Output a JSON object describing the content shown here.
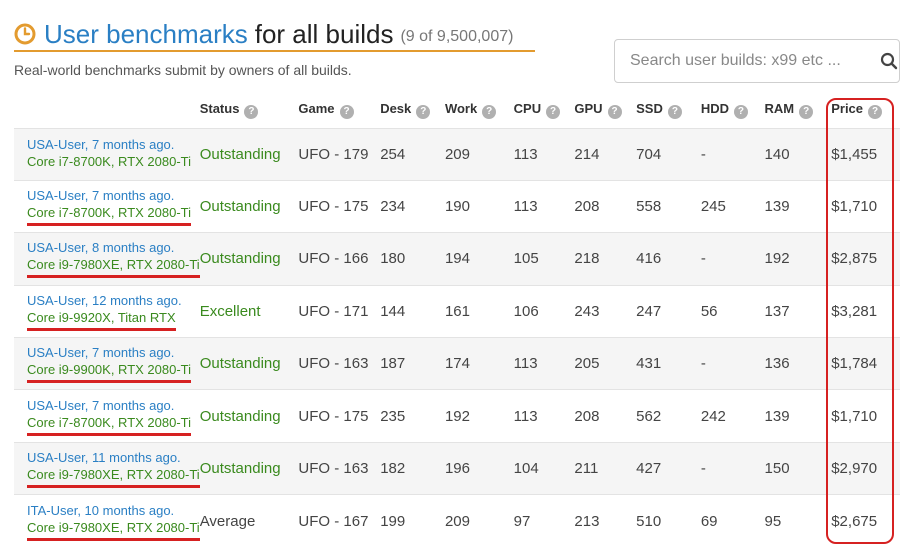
{
  "header": {
    "title_link": "User benchmarks",
    "title_rest": "for all builds",
    "count": "(9 of 9,500,007)",
    "subtitle": "Real-world benchmarks submit by owners of all builds."
  },
  "search": {
    "placeholder": "Search user builds: x99 etc ..."
  },
  "columns": [
    "Status",
    "Game",
    "Desk",
    "Work",
    "CPU",
    "GPU",
    "SSD",
    "HDD",
    "RAM",
    "Price"
  ],
  "colors": {
    "link": "#2a7fc4",
    "green": "#3a8a1e",
    "accent": "#e39b2f",
    "highlight": "#d62121"
  },
  "rows": [
    {
      "user": "USA-User, 7 months ago.",
      "build": "Core i7-8700K, RTX 2080-Ti",
      "status": "Outstanding",
      "game": "UFO - 179",
      "desk": "254",
      "work": "209",
      "cpu": "113",
      "gpu": "214",
      "ssd": "704",
      "hdd": "-",
      "ram": "140",
      "price": "$1,455"
    },
    {
      "user": "USA-User, 7 months ago.",
      "build": "Core i7-8700K, RTX 2080-Ti",
      "status": "Outstanding",
      "game": "UFO - 175",
      "desk": "234",
      "work": "190",
      "cpu": "113",
      "gpu": "208",
      "ssd": "558",
      "hdd": "245",
      "ram": "139",
      "price": "$1,710"
    },
    {
      "user": "USA-User, 8 months ago.",
      "build": "Core i9-7980XE, RTX 2080-Ti",
      "status": "Outstanding",
      "game": "UFO - 166",
      "desk": "180",
      "work": "194",
      "cpu": "105",
      "gpu": "218",
      "ssd": "416",
      "hdd": "-",
      "ram": "192",
      "price": "$2,875"
    },
    {
      "user": "USA-User, 12 months ago.",
      "build": "Core i9-9920X, Titan RTX",
      "status": "Excellent",
      "game": "UFO - 171",
      "desk": "144",
      "work": "161",
      "cpu": "106",
      "gpu": "243",
      "ssd": "247",
      "hdd": "56",
      "ram": "137",
      "price": "$3,281"
    },
    {
      "user": "USA-User, 7 months ago.",
      "build": "Core i9-9900K, RTX 2080-Ti",
      "status": "Outstanding",
      "game": "UFO - 163",
      "desk": "187",
      "work": "174",
      "cpu": "113",
      "gpu": "205",
      "ssd": "431",
      "hdd": "-",
      "ram": "136",
      "price": "$1,784"
    },
    {
      "user": "USA-User, 7 months ago.",
      "build": "Core i7-8700K, RTX 2080-Ti",
      "status": "Outstanding",
      "game": "UFO - 175",
      "desk": "235",
      "work": "192",
      "cpu": "113",
      "gpu": "208",
      "ssd": "562",
      "hdd": "242",
      "ram": "139",
      "price": "$1,710"
    },
    {
      "user": "USA-User, 11 months ago.",
      "build": "Core i9-7980XE, RTX 2080-Ti",
      "status": "Outstanding",
      "game": "UFO - 163",
      "desk": "182",
      "work": "196",
      "cpu": "104",
      "gpu": "211",
      "ssd": "427",
      "hdd": "-",
      "ram": "150",
      "price": "$2,970"
    },
    {
      "user": "ITA-User, 10 months ago.",
      "build": "Core i9-7980XE, RTX 2080-Ti",
      "status": "Average",
      "game": "UFO - 167",
      "desk": "199",
      "work": "209",
      "cpu": "97",
      "gpu": "213",
      "ssd": "510",
      "hdd": "69",
      "ram": "95",
      "price": "$2,675"
    }
  ]
}
